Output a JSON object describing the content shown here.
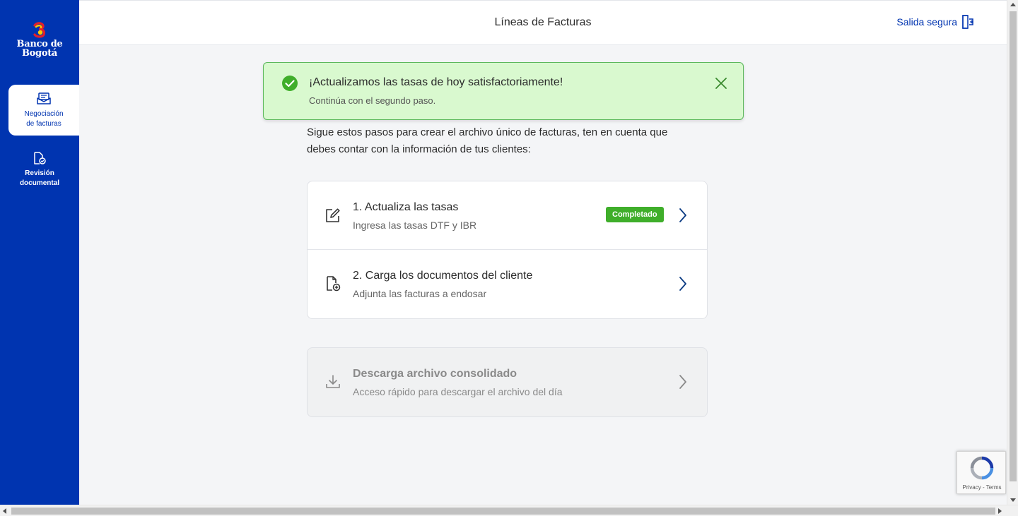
{
  "sidebar": {
    "logo_line1": "Banco de",
    "logo_line2": "Bogotá",
    "items": [
      {
        "line1": "Negociación",
        "line2": "de facturas",
        "icon": "envelope-icon",
        "active": true
      },
      {
        "line1": "Revisión",
        "line2": "documental",
        "icon": "document-check-icon",
        "active": false
      }
    ]
  },
  "header": {
    "title": "Líneas de Facturas",
    "logout_label": "Salida segura"
  },
  "toast": {
    "title": "¡Actualizamos las tasas de hoy satisfactoriamente!",
    "subtitle": "Continúa con el segundo paso."
  },
  "intro": {
    "line1": "Sigue estos pasos para crear el archivo único de facturas, ten en cuenta que",
    "line2": "debes contar con la información de tus clientes:"
  },
  "steps": [
    {
      "title": "1. Actualiza las tasas",
      "subtitle": "Ingresa las tasas DTF y IBR",
      "badge": "Completado",
      "icon": "edit-icon"
    },
    {
      "title": "2. Carga los documentos del cliente",
      "subtitle": "Adjunta las facturas a endosar",
      "icon": "file-add-icon"
    }
  ],
  "download": {
    "title": "Descarga archivo consolidado",
    "subtitle": "Acceso rápido para descargar el archivo del día",
    "icon": "download-icon"
  },
  "recaptcha": {
    "links": "Privacy - Terms"
  },
  "colors": {
    "brand": "#0034b0",
    "success_bg": "#d9f9cf",
    "success_border": "#5cb85c",
    "badge": "#3fae2a"
  }
}
